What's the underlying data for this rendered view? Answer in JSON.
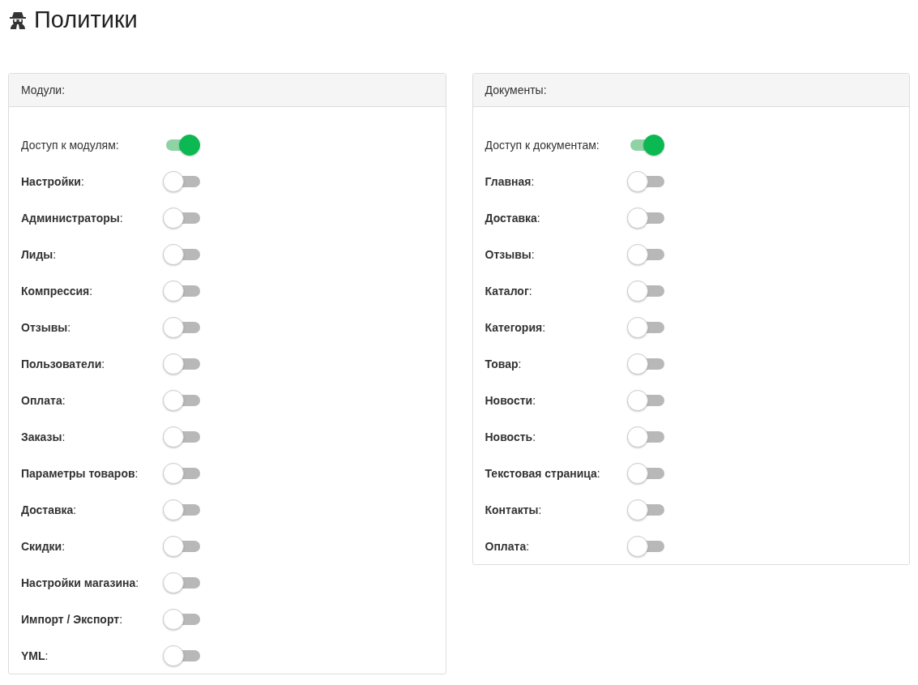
{
  "page_title": "Политики",
  "panels": [
    {
      "title": "Модули:",
      "items": [
        {
          "label": "Доступ к модулям:",
          "on": true
        },
        {
          "label": "**Настройки**:",
          "on": false
        },
        {
          "label": "**Администраторы**:",
          "on": false
        },
        {
          "label": "**Лиды**:",
          "on": false
        },
        {
          "label": "**Компрессия**:",
          "on": false
        },
        {
          "label": "**Отзывы**:",
          "on": false
        },
        {
          "label": "**Пользователи**:",
          "on": false
        },
        {
          "label": "**Оплата**:",
          "on": false
        },
        {
          "label": "**Заказы**:",
          "on": false
        },
        {
          "label": "**Параметры товаров**:",
          "on": false
        },
        {
          "label": "**Доставка**:",
          "on": false
        },
        {
          "label": "**Скидки**:",
          "on": false
        },
        {
          "label": "**Настройки магазина**:",
          "on": false
        },
        {
          "label": "**Импорт / Экспорт**:",
          "on": false
        },
        {
          "label": "**YML**:",
          "on": false
        }
      ]
    },
    {
      "title": "Документы:",
      "items": [
        {
          "label": "Доступ к документам:",
          "on": true
        },
        {
          "label": "**Главная**:",
          "on": false
        },
        {
          "label": "**Доставка**:",
          "on": false
        },
        {
          "label": "**Отзывы**:",
          "on": false
        },
        {
          "label": "**Каталог**:",
          "on": false
        },
        {
          "label": "**Категория**:",
          "on": false
        },
        {
          "label": "**Товар**:",
          "on": false
        },
        {
          "label": "**Новости**:",
          "on": false
        },
        {
          "label": "**Новость**:",
          "on": false
        },
        {
          "label": "**Текстовая страница**:",
          "on": false
        },
        {
          "label": "**Контакты**:",
          "on": false
        },
        {
          "label": "**Оплата**:",
          "on": false
        }
      ]
    }
  ]
}
